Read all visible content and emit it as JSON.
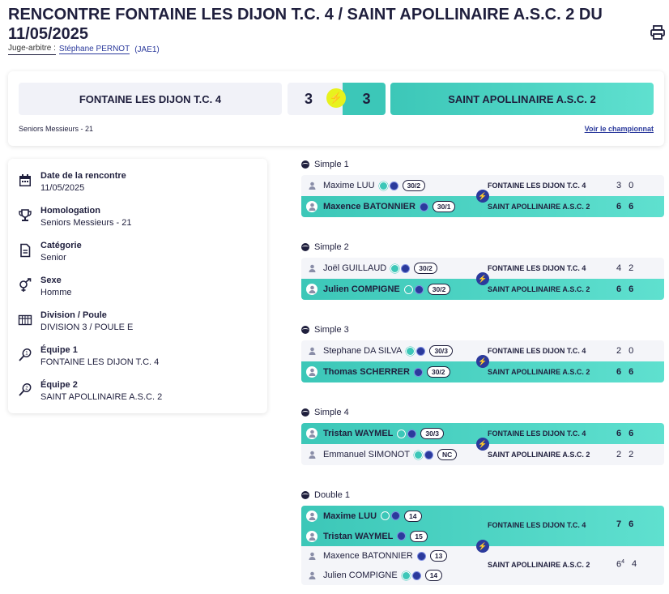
{
  "header": {
    "title": "RENCONTRE FONTAINE LES DIJON T.C. 4 / SAINT APOLLINAIRE A.S.C. 2 DU 11/05/2025",
    "referee_label": "Juge-arbitre :",
    "referee_name": "Stéphane PERNOT",
    "referee_code": "(JAE1)",
    "print_icon": "printer-icon"
  },
  "scoreboard": {
    "home_team": "FONTAINE LES DIJON T.C. 4",
    "home_score": "3",
    "away_score": "3",
    "away_team": "SAINT APOLLINAIRE A.S.C. 2",
    "category": "Seniors Messieurs - 21",
    "championship_link": "Voir le championnat",
    "highlight_color": "#3cc7b8",
    "bolt_color": "#e8f21d"
  },
  "info": [
    {
      "icon": "calendar-icon",
      "label": "Date de la rencontre",
      "value": "11/05/2025"
    },
    {
      "icon": "trophy-icon",
      "label": "Homologation",
      "value": "Seniors Messieurs - 21"
    },
    {
      "icon": "document-icon",
      "label": "Catégorie",
      "value": "Senior"
    },
    {
      "icon": "gender-icon",
      "label": "Sexe",
      "value": "Homme"
    },
    {
      "icon": "grid-icon",
      "label": "Division / Poule",
      "value": "DIVISION 3 / POULE E"
    },
    {
      "icon": "racket-1-icon",
      "label": "Équipe 1",
      "value": "FONTAINE LES DIJON T.C. 4"
    },
    {
      "icon": "racket-2-icon",
      "label": "Équipe 2",
      "value": "SAINT APOLLINAIRE A.S.C. 2"
    }
  ],
  "matches": [
    {
      "title": "Simple 1",
      "p1": {
        "name": "Maxime LUU",
        "rank": "30/2",
        "team": "FONTAINE LES DIJON T.C. 4",
        "s1": "3",
        "s2": "0"
      },
      "p2": {
        "name": "Maxence BATONNIER",
        "rank": "30/1",
        "team": "SAINT APOLLINAIRE A.S.C. 2",
        "s1": "6",
        "s2": "6"
      }
    },
    {
      "title": "Simple 2",
      "p1": {
        "name": "Joël GUILLAUD",
        "rank": "30/2",
        "team": "FONTAINE LES DIJON T.C. 4",
        "s1": "4",
        "s2": "2"
      },
      "p2": {
        "name": "Julien COMPIGNE",
        "rank": "30/2",
        "team": "SAINT APOLLINAIRE A.S.C. 2",
        "s1": "6",
        "s2": "6"
      }
    },
    {
      "title": "Simple 3",
      "p1": {
        "name": "Stephane DA SILVA",
        "rank": "30/3",
        "team": "FONTAINE LES DIJON T.C. 4",
        "s1": "2",
        "s2": "0"
      },
      "p2": {
        "name": "Thomas SCHERRER",
        "rank": "30/2",
        "team": "SAINT APOLLINAIRE A.S.C. 2",
        "s1": "6",
        "s2": "6"
      }
    },
    {
      "title": "Simple 4",
      "p1": {
        "name": "Tristan WAYMEL",
        "rank": "30/3",
        "team": "FONTAINE LES DIJON T.C. 4",
        "s1": "6",
        "s2": "6"
      },
      "p2": {
        "name": "Emmanuel SIMONOT",
        "rank": "NC",
        "team": "SAINT APOLLINAIRE A.S.C. 2",
        "s1": "2",
        "s2": "2"
      }
    }
  ],
  "double": {
    "title": "Double 1",
    "home": {
      "team": "FONTAINE LES DIJON T.C. 4",
      "p1": "Maxime LUU",
      "p1_rank": "14",
      "p2": "Tristan WAYMEL",
      "p2_rank": "15",
      "s1": "7",
      "s2": "6"
    },
    "away": {
      "team": "SAINT APOLLINAIRE A.S.C. 2",
      "p1": "Maxence BATONNIER",
      "p1_rank": "13",
      "p2": "Julien COMPIGNE",
      "p2_rank": "14",
      "s1": "6",
      "s1_tiebreak": "4",
      "s2": "4"
    }
  }
}
